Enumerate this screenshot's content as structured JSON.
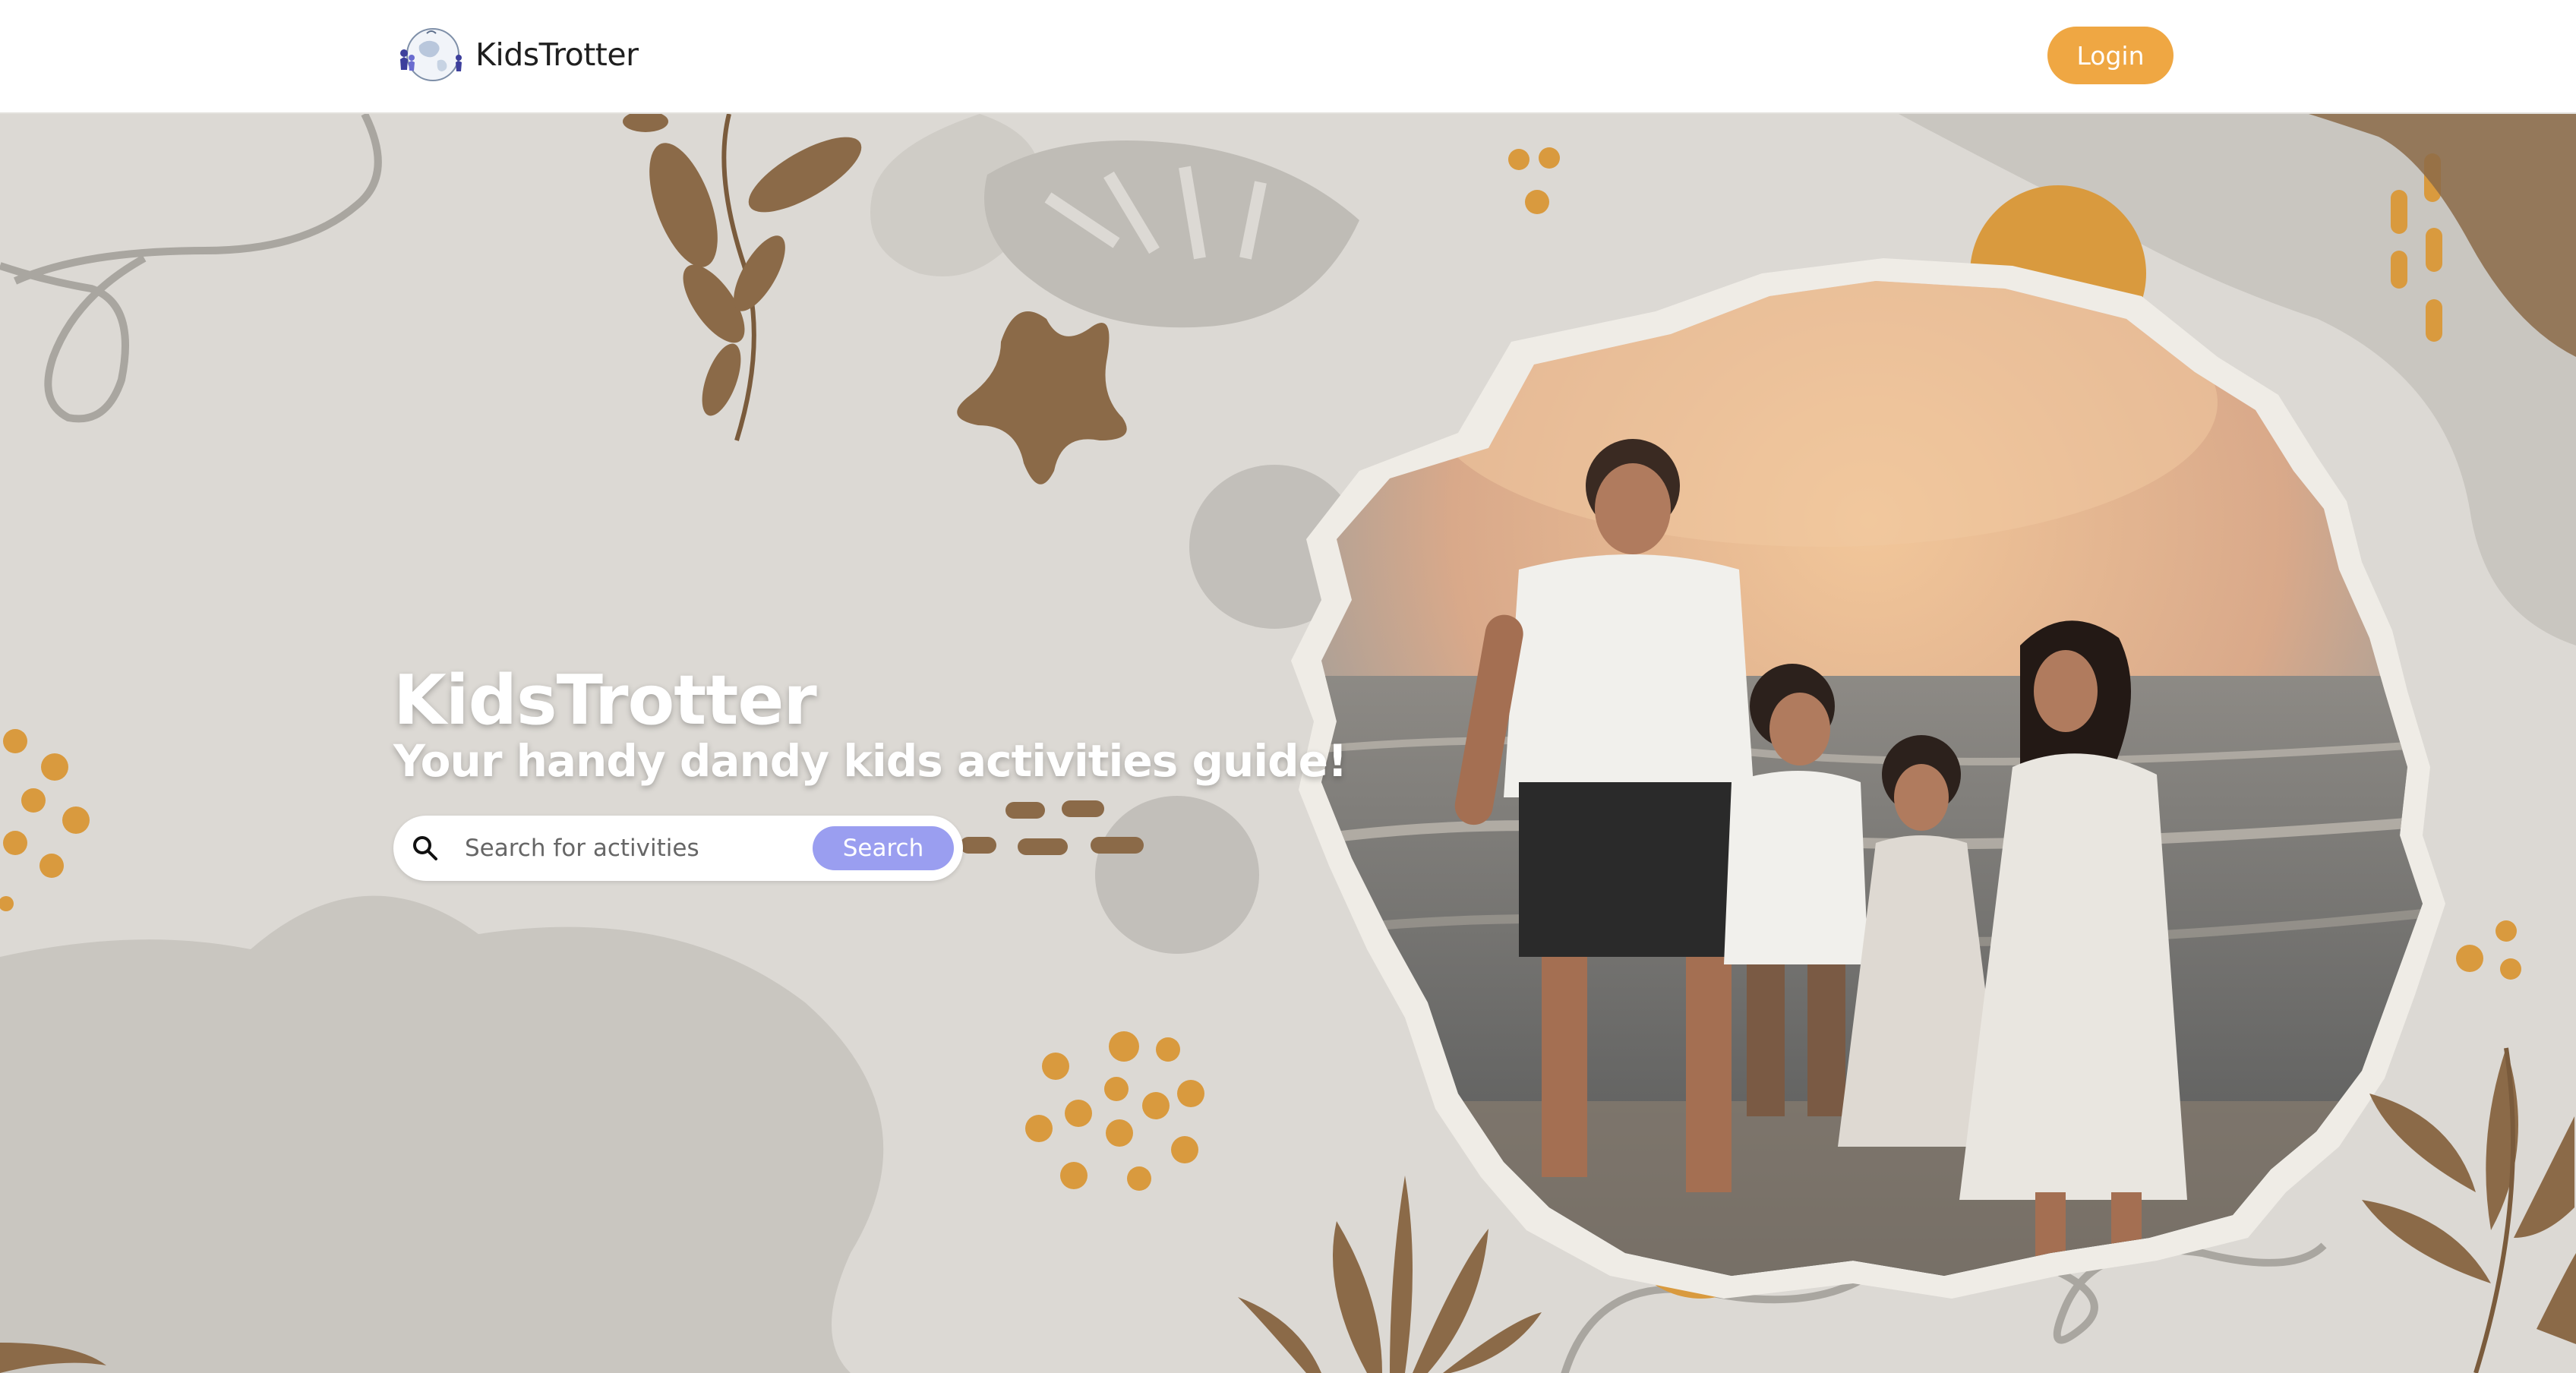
{
  "header": {
    "brand_name": "KidsTrotter",
    "login_label": "Login",
    "logo_icon": "globe-with-kids-logo"
  },
  "hero": {
    "title": "KidsTrotter",
    "subtitle": "Your handy dandy kids activities guide!",
    "search": {
      "placeholder": "Search for activities",
      "value": "",
      "button_label": "Search",
      "icon": "search-icon"
    },
    "photo_subject": "family-on-beach-photo"
  },
  "colors": {
    "accent_orange": "#efa743",
    "search_button": "#9a9ef0",
    "background": "#dcd9d4",
    "brown_decor": "#8b6a48",
    "mustard_decor": "#d99a3e"
  }
}
